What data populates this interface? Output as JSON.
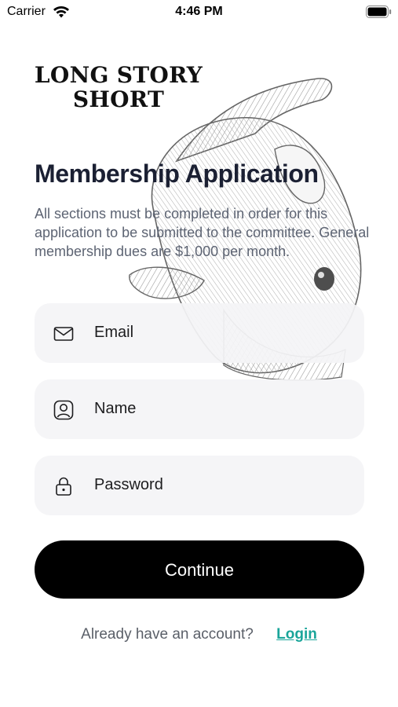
{
  "status_bar": {
    "carrier": "Carrier",
    "time": "4:46 PM"
  },
  "brand": {
    "line1": "LONG STORY",
    "line2": "SHORT"
  },
  "page": {
    "title": "Membership Application",
    "description": "All sections must be completed in order for this application to be submitted to the committee. General membership dues are $1,000 per month."
  },
  "form": {
    "fields": [
      {
        "label": "Email",
        "icon": "envelope-icon"
      },
      {
        "label": "Name",
        "icon": "user-circle-icon"
      },
      {
        "label": "Password",
        "icon": "lock-icon"
      }
    ],
    "continue_label": "Continue"
  },
  "footer": {
    "prompt": "Already have an account?",
    "login_label": "Login"
  },
  "colors": {
    "accent": "#1aa59a",
    "button": "#000000",
    "field_bg": "#f4f4f6"
  }
}
